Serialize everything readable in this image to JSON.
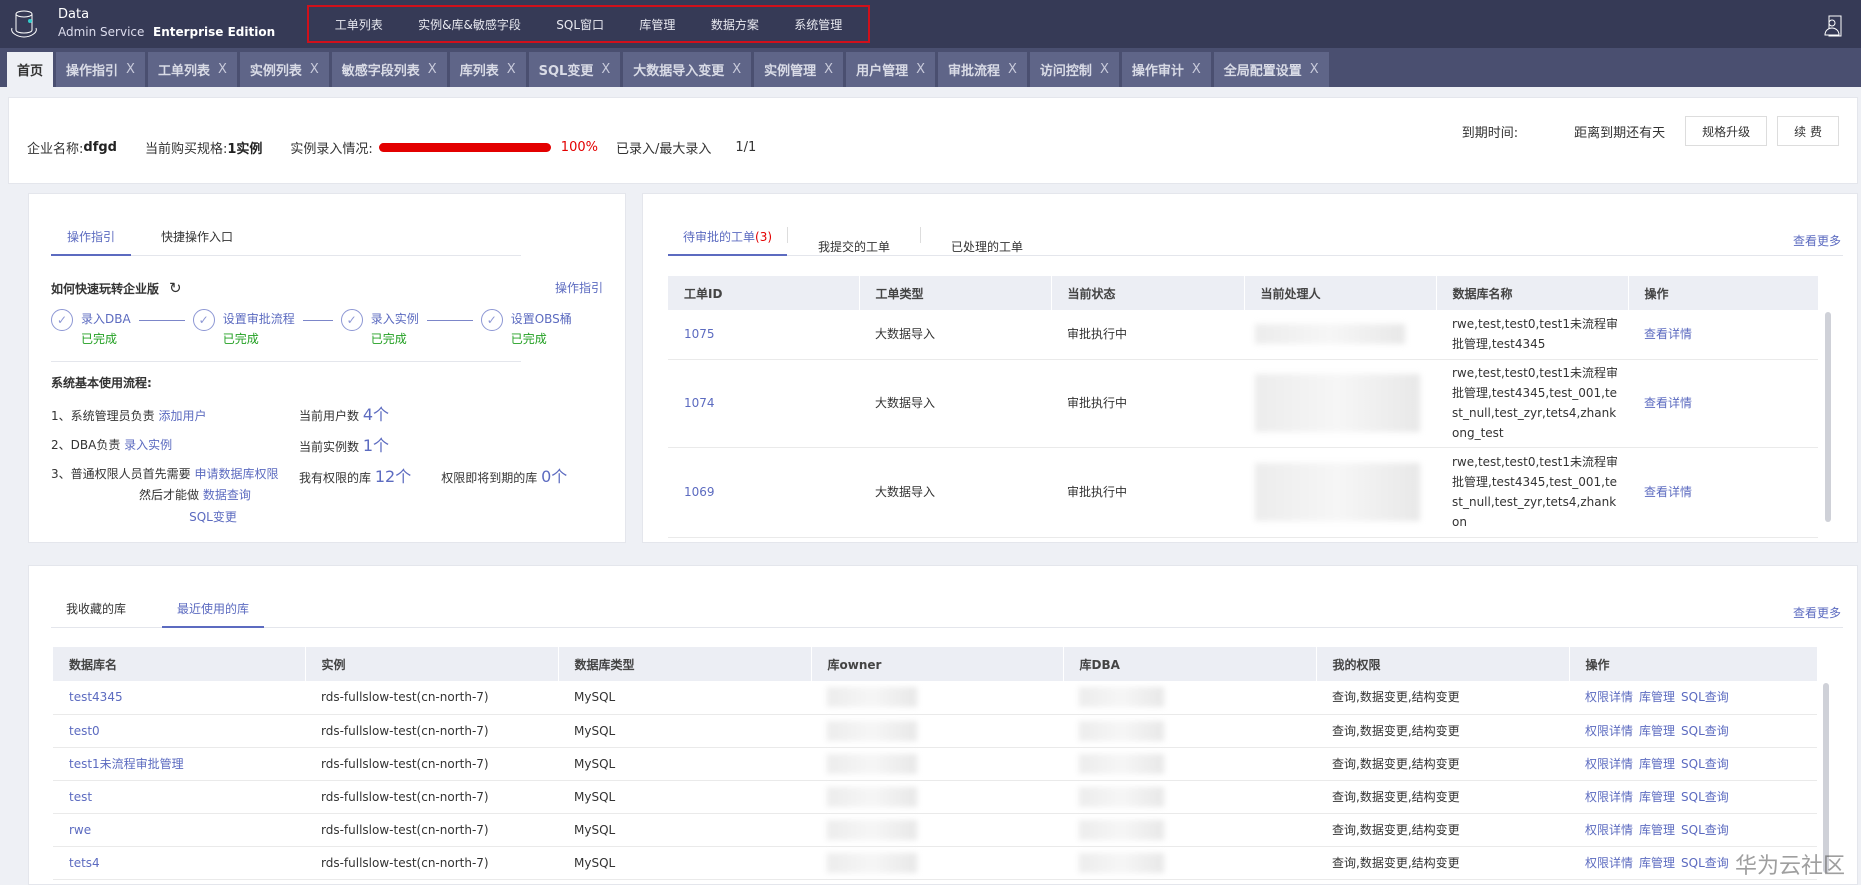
{
  "header": {
    "logo_line1": "Data",
    "logo_line2": "Admin Service",
    "edition": "Enterprise Edition",
    "nav": [
      "工单列表",
      "实例&库&敏感字段",
      "SQL窗口",
      "库管理",
      "数据方案",
      "系统管理"
    ]
  },
  "tabs": [
    {
      "label": "首页",
      "active": true
    },
    {
      "label": "操作指引"
    },
    {
      "label": "工单列表"
    },
    {
      "label": "实例列表"
    },
    {
      "label": "敏感字段列表"
    },
    {
      "label": "库列表"
    },
    {
      "label": "SQL变更"
    },
    {
      "label": "大数据导入变更"
    },
    {
      "label": "实例管理"
    },
    {
      "label": "用户管理"
    },
    {
      "label": "审批流程"
    },
    {
      "label": "访问控制"
    },
    {
      "label": "操作审计"
    },
    {
      "label": "全局配置设置"
    }
  ],
  "tab_close": "X",
  "info": {
    "company_label": "企业名称:",
    "company": "dfgd",
    "spec_label": "当前购买规格:",
    "spec": "1实例",
    "entry_label": "实例录入情况:",
    "progress_percent": 100,
    "progress_text": "100%",
    "entered_label": "已录入/最大录入",
    "entered_value": "1/1",
    "expire_label": "到期时间:",
    "expire_remaining": "距离到期还有天",
    "upgrade_btn": "规格升级",
    "renew_btn": "续 费"
  },
  "guide": {
    "tabs": [
      "操作指引",
      "快捷操作入口"
    ],
    "title": "如何快速玩转企业版",
    "link": "操作指引",
    "steps": [
      {
        "label": "录入DBA",
        "status": "已完成"
      },
      {
        "label": "设置审批流程",
        "status": "已完成"
      },
      {
        "label": "录入实例",
        "status": "已完成"
      },
      {
        "label": "设置OBS桶",
        "status": "已完成"
      }
    ],
    "flow_title": "系统基本使用流程:",
    "flow": [
      {
        "text": "1、系统管理员负责",
        "link": "添加用户"
      },
      {
        "text": "2、DBA负责",
        "link": "录入实例"
      },
      {
        "text": "3、普通权限人员首先需要",
        "link": "申请数据库权限"
      }
    ],
    "then_text": "然后才能做",
    "then_links": [
      "数据查询",
      "SQL变更"
    ],
    "stats": [
      {
        "label": "当前用户数",
        "value": "4个"
      },
      {
        "label": "当前实例数",
        "value": "1个"
      },
      {
        "label": "我有权限的库",
        "value": "12个"
      },
      {
        "label": "权限即将到期的库",
        "value": "0个"
      }
    ]
  },
  "orders": {
    "tabs": [
      "待审批的工单",
      "(3)",
      "我提交的工单",
      "已处理的工单"
    ],
    "more": "查看更多",
    "columns": [
      "工单ID",
      "工单类型",
      "当前状态",
      "当前处理人",
      "数据库名称",
      "操作"
    ],
    "rows": [
      {
        "id": "1075",
        "type": "大数据导入",
        "status": "审批执行中",
        "db": "rwe,test,test0,test1未流程审批管理,test4345",
        "action": "查看详情"
      },
      {
        "id": "1074",
        "type": "大数据导入",
        "status": "审批执行中",
        "db": "rwe,test,test0,test1未流程审批管理,test4345,test_001,test_null,test_zyr,tets4,zhankong_test",
        "action": "查看详情"
      },
      {
        "id": "1069",
        "type": "大数据导入",
        "status": "审批执行中",
        "db": "rwe,test,test0,test1未流程审批管理,test4345,test_001,test_null,test_zyr,tets4,zhankon",
        "action": "查看详情"
      }
    ]
  },
  "dbs": {
    "tabs": [
      "我收藏的库",
      "最近使用的库"
    ],
    "more": "查看更多",
    "columns": [
      "数据库名",
      "实例",
      "数据库类型",
      "库owner",
      "库DBA",
      "我的权限",
      "操作"
    ],
    "actions": [
      "权限详情",
      "库管理",
      "SQL查询"
    ],
    "rows": [
      {
        "name": "test4345",
        "instance": "rds-fullslow-test(cn-north-7)",
        "type": "MySQL",
        "perm": "查询,数据变更,结构变更"
      },
      {
        "name": "test0",
        "instance": "rds-fullslow-test(cn-north-7)",
        "type": "MySQL",
        "perm": "查询,数据变更,结构变更"
      },
      {
        "name": "test1未流程审批管理",
        "instance": "rds-fullslow-test(cn-north-7)",
        "type": "MySQL",
        "perm": "查询,数据变更,结构变更"
      },
      {
        "name": "test",
        "instance": "rds-fullslow-test(cn-north-7)",
        "type": "MySQL",
        "perm": "查询,数据变更,结构变更"
      },
      {
        "name": "rwe",
        "instance": "rds-fullslow-test(cn-north-7)",
        "type": "MySQL",
        "perm": "查询,数据变更,结构变更"
      },
      {
        "name": "tets4",
        "instance": "rds-fullslow-test(cn-north-7)",
        "type": "MySQL",
        "perm": "查询,数据变更,结构变更"
      }
    ]
  },
  "watermark": "华为云社区"
}
